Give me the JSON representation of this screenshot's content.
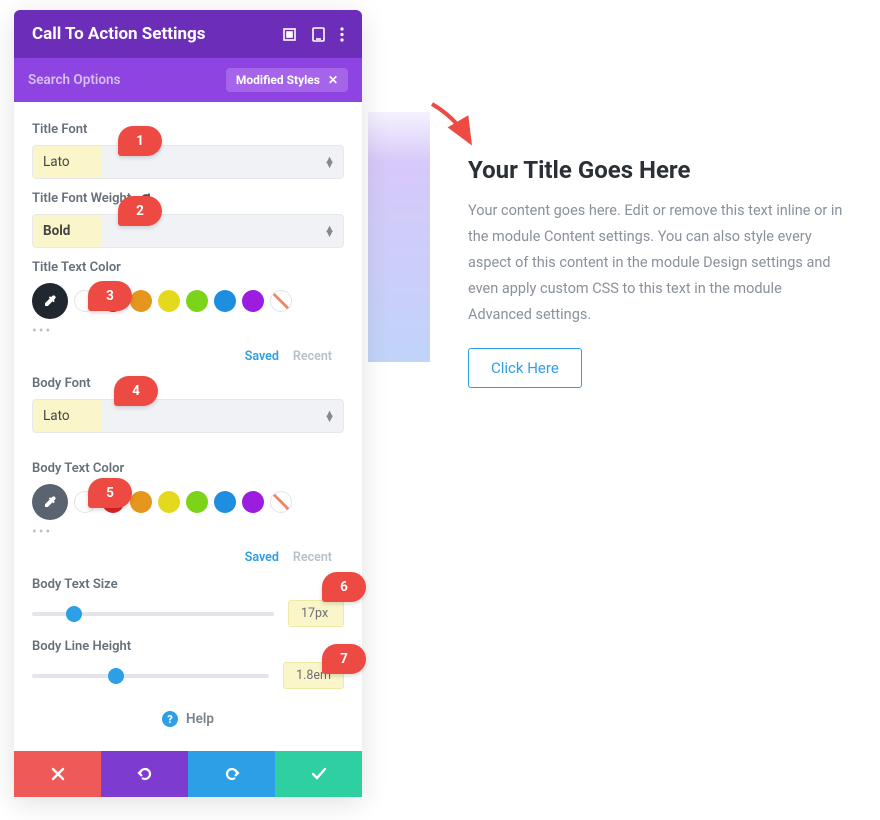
{
  "header": {
    "title": "Call To Action Settings"
  },
  "subbar": {
    "search": "Search Options",
    "chip": "Modified Styles"
  },
  "fields": {
    "titleFont": {
      "label": "Title Font",
      "value": "Lato"
    },
    "titleFontWeight": {
      "label": "Title Font Weight",
      "value": "Bold"
    },
    "titleTextColor": {
      "label": "Title Text Color"
    },
    "bodyFont": {
      "label": "Body Font",
      "value": "Lato"
    },
    "bodyTextColor": {
      "label": "Body Text Color"
    },
    "bodyTextSize": {
      "label": "Body Text Size",
      "value": "17px"
    },
    "bodyLineHeight": {
      "label": "Body Line Height",
      "value": "1.8em"
    }
  },
  "colorTabs": {
    "saved": "Saved",
    "recent": "Recent"
  },
  "palette": [
    "#ffffff",
    "#e12323",
    "#e5961d",
    "#e5d91d",
    "#7bd31a",
    "#1e8fe0",
    "#9b1ee0"
  ],
  "help": "Help",
  "callouts": {
    "c1": "1",
    "c2": "2",
    "c3": "3",
    "c4": "4",
    "c5": "5",
    "c6": "6",
    "c7": "7"
  },
  "preview": {
    "title": "Your Title Goes Here",
    "body": "Your content goes here. Edit or remove this text inline or in the module Content settings. You can also style every aspect of this content in the module Design settings and even apply custom CSS to this text in the module Advanced settings.",
    "button": "Click Here"
  }
}
